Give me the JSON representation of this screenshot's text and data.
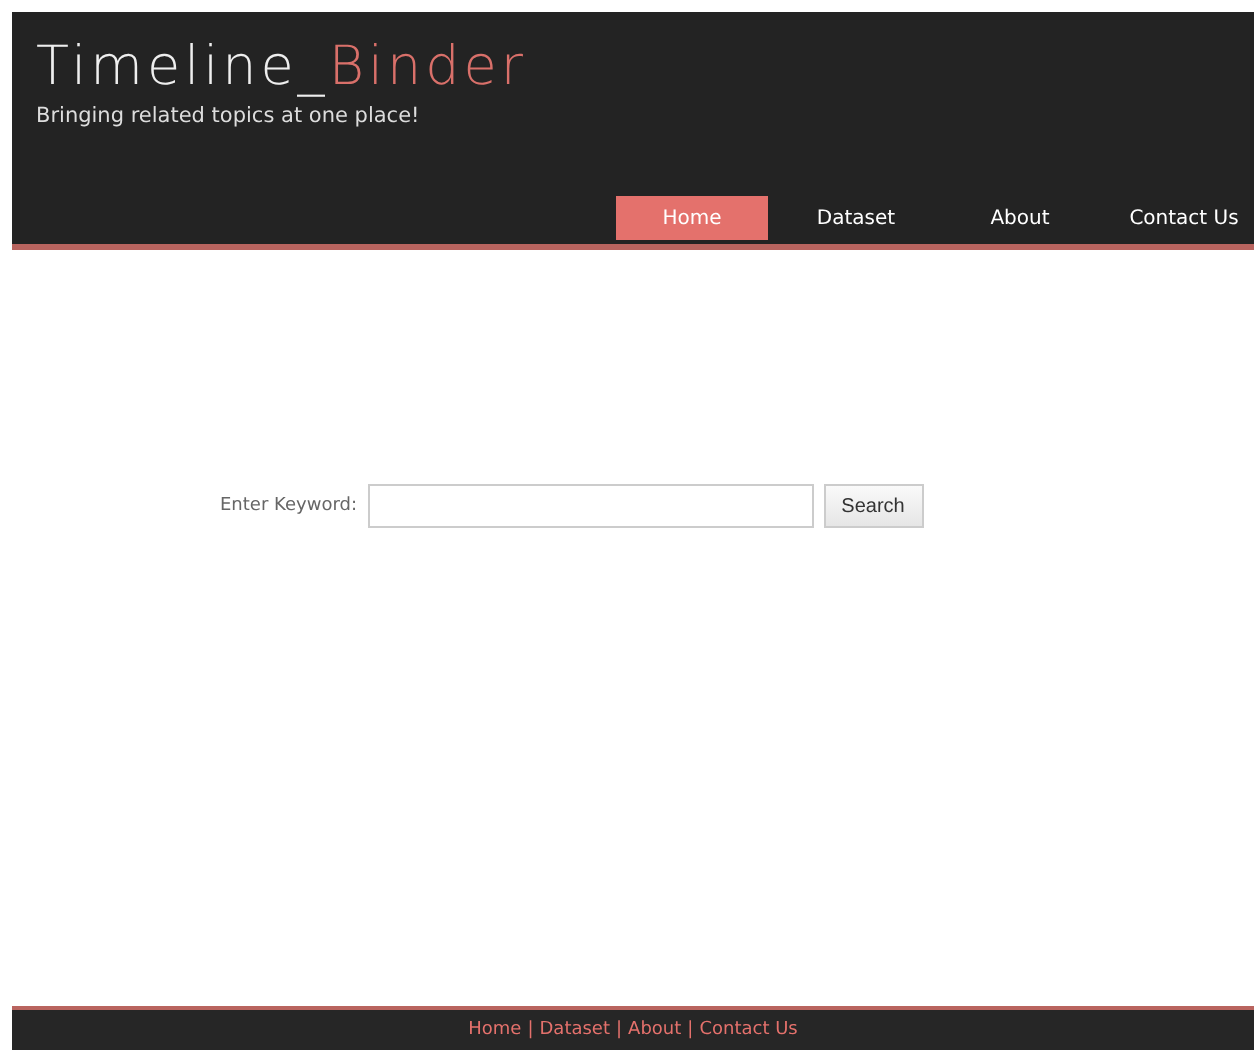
{
  "header": {
    "title_part_1": "Timeline_",
    "title_part_2": "Binder",
    "tagline": "Bringing related topics at one place!"
  },
  "nav": [
    {
      "label": "Home",
      "selected": true
    },
    {
      "label": "Dataset",
      "selected": false
    },
    {
      "label": "About",
      "selected": false
    },
    {
      "label": "Contact Us",
      "selected": false
    }
  ],
  "search": {
    "label": "Enter Keyword:",
    "button": "Search"
  },
  "footer": {
    "links": [
      "Home",
      "Dataset",
      "About",
      "Contact Us"
    ],
    "separator": "|"
  }
}
